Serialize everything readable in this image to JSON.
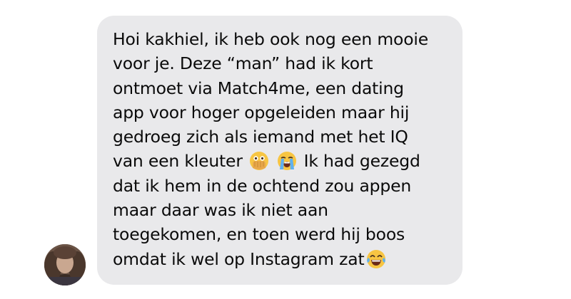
{
  "message": {
    "lines": [
      "Hoi kakhiel, ik heb ook nog een mooie",
      "voor je. Deze “man” had ik kort",
      "ontmoet via Match4me, een dating",
      "app voor hoger opgeleiden maar hij",
      "gedroeg zich als iemand met het IQ",
      "van een kleuter",
      "Ik had gezegd",
      "dat ik hem in de ochtend zou appen",
      "maar daar was ik niet aan",
      "toegekomen, en toen werd hij boos",
      "omdat ik wel op Instagram zat"
    ],
    "emojis": [
      "face-with-open-eyes-and-hand-over-mouth-emoji",
      "loudly-crying-face-emoji",
      "face-with-tears-of-joy-emoji"
    ]
  },
  "colors": {
    "bubble": "#e9e9eb",
    "text": "#0a0a0a",
    "background": "#ffffff"
  }
}
